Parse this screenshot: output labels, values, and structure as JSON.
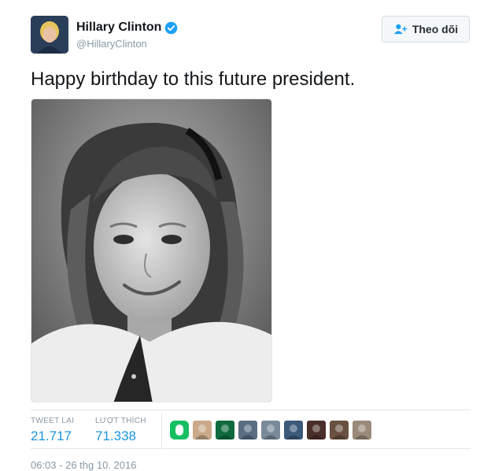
{
  "user": {
    "name": "Hillary Clinton",
    "handle": "@HillaryClinton",
    "verified": true
  },
  "follow_button": {
    "label": "Theo dõi",
    "icon": "add-user-icon"
  },
  "tweet": {
    "text": "Happy birthday to this future president.",
    "image_icon": "portrait-photo"
  },
  "stats": {
    "retweets": {
      "label": "TWEET LẠI",
      "value": "21.717"
    },
    "likes": {
      "label": "LƯỢT THÍCH",
      "value": "71.338"
    }
  },
  "likers": [
    {
      "name": "liker-1",
      "color": "#17bf63"
    },
    {
      "name": "liker-2",
      "color": "#c9a98a"
    },
    {
      "name": "liker-3",
      "color": "#0f6b3d"
    },
    {
      "name": "liker-4",
      "color": "#5a6e82"
    },
    {
      "name": "liker-5",
      "color": "#7a8a9a"
    },
    {
      "name": "liker-6",
      "color": "#3b5a7a"
    },
    {
      "name": "liker-7",
      "color": "#4a2e2a"
    },
    {
      "name": "liker-8",
      "color": "#6a5040"
    },
    {
      "name": "liker-9",
      "color": "#9a8a7a"
    }
  ],
  "timestamp": "06:03 - 26 thg 10. 2016",
  "colors": {
    "link_blue": "#1b95e0",
    "verified_blue": "#1da1f2",
    "meta_gray": "#8899a6",
    "border": "#e1e8ed"
  }
}
